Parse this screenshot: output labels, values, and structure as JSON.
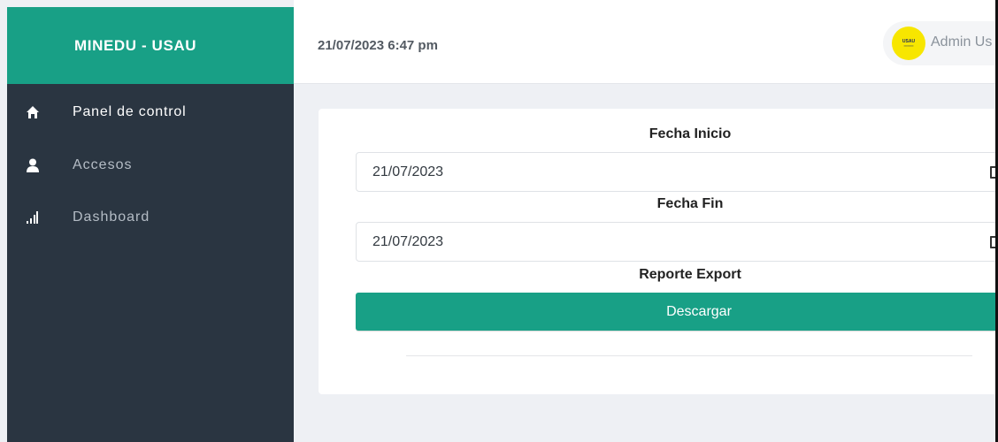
{
  "sidebar": {
    "brand": "MINEDU - USAU",
    "items": [
      {
        "label": "Panel de control",
        "icon": "home-icon",
        "active": true
      },
      {
        "label": "Accesos",
        "icon": "user-icon",
        "active": false
      },
      {
        "label": "Dashboard",
        "icon": "signal-bars-icon",
        "active": false
      }
    ]
  },
  "topbar": {
    "datetime": "21/07/2023 6:47 pm",
    "avatar_text": "USAU",
    "user_name": "Admin Us"
  },
  "form": {
    "start_label": "Fecha Inicio",
    "start_value": "21/07/2023",
    "end_label": "Fecha Fin",
    "end_value": "21/07/2023",
    "export_label": "Reporte Export",
    "download_label": "Descargar"
  },
  "colors": {
    "accent": "#18a086",
    "sidebar": "#2a3541",
    "avatar": "#f7e600"
  }
}
